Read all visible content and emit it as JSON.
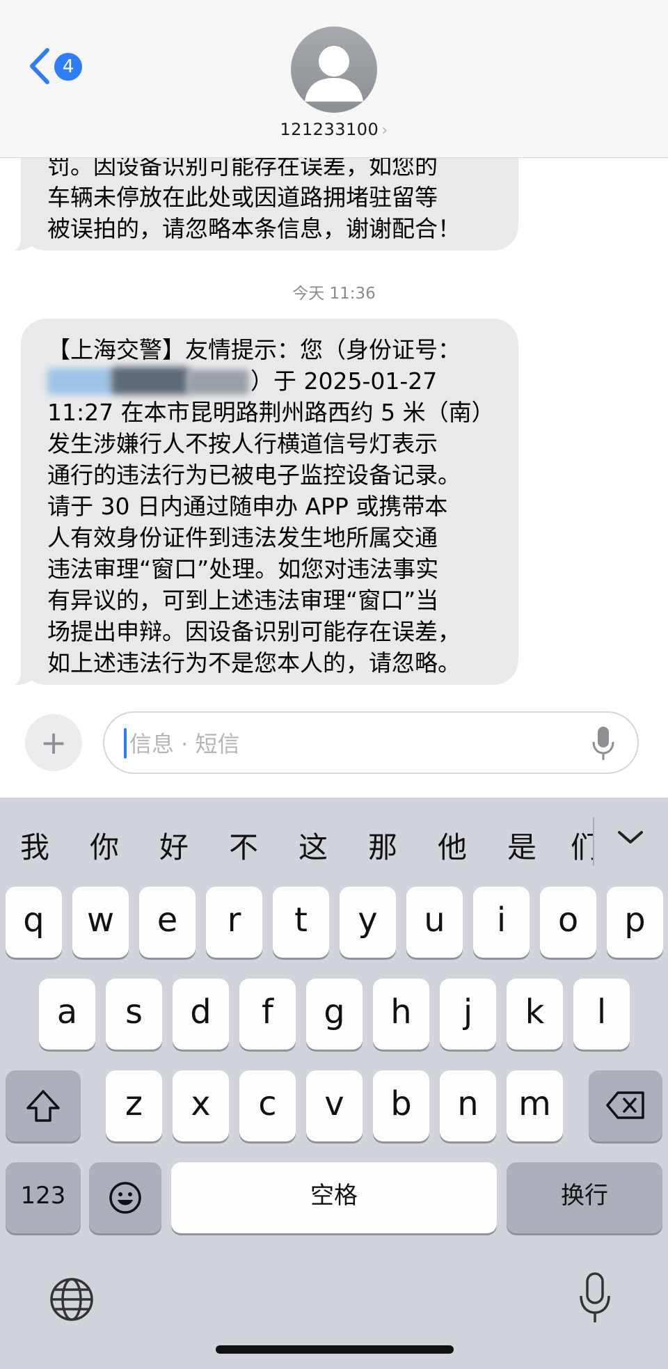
{
  "header": {
    "back_badge": "4",
    "contact_name": "121233100",
    "contact_arrow": "›"
  },
  "messages": {
    "previous": [
      "罚。因设备识别可能存在误差，如您的",
      "车辆未停放在此处或因道路拥堵驻留等",
      "被误拍的，请忽略本条信息，谢谢配合！"
    ],
    "timestamp": "今天 11:36",
    "main": {
      "line1": "【上海交警】友情提示：您（身份证号：",
      "line2_visible": "）于 2025-01-27",
      "line3": "11:27 在本市昆明路荆州路西约 5 米（南）",
      "line4": "发生涉嫌行人不按人行横道信号灯表示",
      "line5": "通行的违法行为已被电子监控设备记录。",
      "line6": "请于 30 日内通过随申办 APP 或携带本",
      "line7": "人有效身份证件到违法发生地所属交通",
      "line8": "违法审理“窗口”处理。如您对违法事实",
      "line9": "有异议的，可到上述违法审理“窗口”当",
      "line10": "场提出申辩。因设备识别可能存在误差，",
      "line11": "如上述违法行为不是您本人的，请忽略。"
    }
  },
  "input": {
    "placeholder": "信息 · 短信"
  },
  "keyboard": {
    "candidates": [
      "我",
      "你",
      "好",
      "不",
      "这",
      "那",
      "他",
      "是",
      "们"
    ],
    "row1": [
      "q",
      "w",
      "e",
      "r",
      "t",
      "y",
      "u",
      "i",
      "o",
      "p"
    ],
    "row2": [
      "a",
      "s",
      "d",
      "f",
      "g",
      "h",
      "j",
      "k",
      "l"
    ],
    "row3": [
      "z",
      "x",
      "c",
      "v",
      "b",
      "n",
      "m"
    ],
    "numbers_label": "123",
    "space_label": "空格",
    "return_label": "换行"
  },
  "colors": {
    "accent": "#2f7df6",
    "bubble": "#e9e9eb",
    "keyboard_bg": "#d1d4da"
  }
}
